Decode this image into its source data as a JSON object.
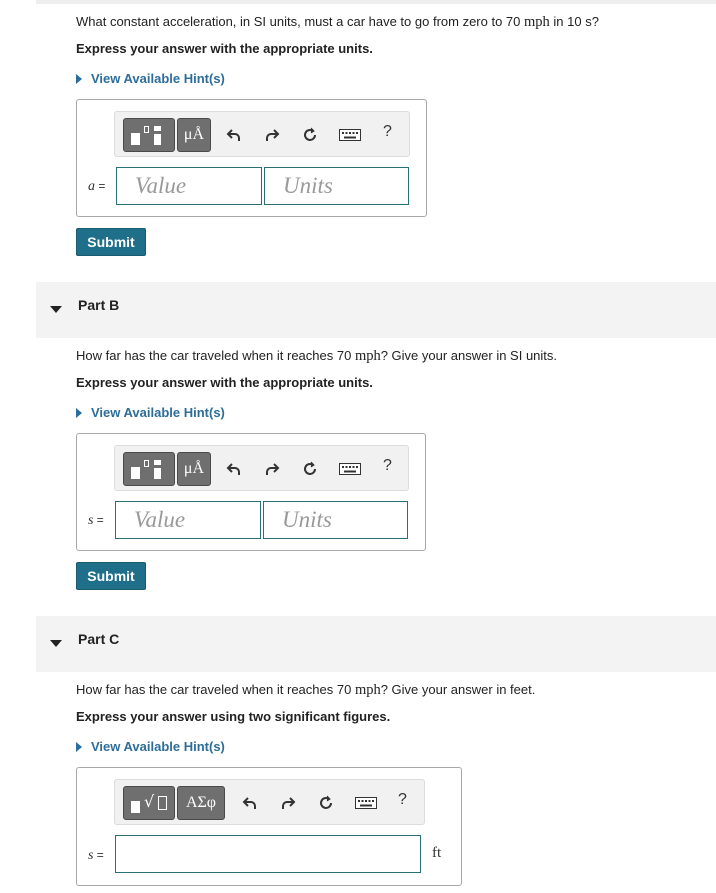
{
  "partA": {
    "question_pre": "What constant acceleration, in SI units, must a car have to go from zero to 70",
    "question_math": "mph",
    "question_post": "in 10 s?",
    "instruction": "Express your answer with the appropriate units.",
    "hint": "View Available Hint(s)",
    "var_label": "a",
    "eq": "=",
    "value_placeholder": "Value",
    "units_placeholder": "Units",
    "submit": "Submit"
  },
  "partB": {
    "title": "Part B",
    "question_pre": "How far has the car traveled when it reaches 70",
    "question_math": "mph",
    "question_post": "? Give your answer in SI units.",
    "instruction": "Express your answer with the appropriate units.",
    "hint": "View Available Hint(s)",
    "var_label": "s",
    "eq": "=",
    "value_placeholder": "Value",
    "units_placeholder": "Units",
    "submit": "Submit"
  },
  "partC": {
    "title": "Part C",
    "question_pre": "How far has the car traveled when it reaches 70",
    "question_math": "mph",
    "question_post": "? Give your answer in feet.",
    "instruction": "Express your answer using two significant figures.",
    "hint": "View Available Hint(s)",
    "var_label": "s",
    "eq": "=",
    "unit": "ft"
  },
  "toolbar": {
    "mu_label": "μÅ",
    "greek_label": "ΑΣφ",
    "help_label": "?",
    "icons": [
      "templates-icon",
      "units-icon",
      "undo-icon",
      "redo-icon",
      "reset-icon",
      "keyboard-icon",
      "help-icon"
    ]
  },
  "colors": {
    "accent": "#1f6f8b",
    "link": "#2d6d9a",
    "input_border": "#2a6f76",
    "toolbar_button": "#6f6f6f",
    "part_header_bg": "#f3f3f3"
  }
}
